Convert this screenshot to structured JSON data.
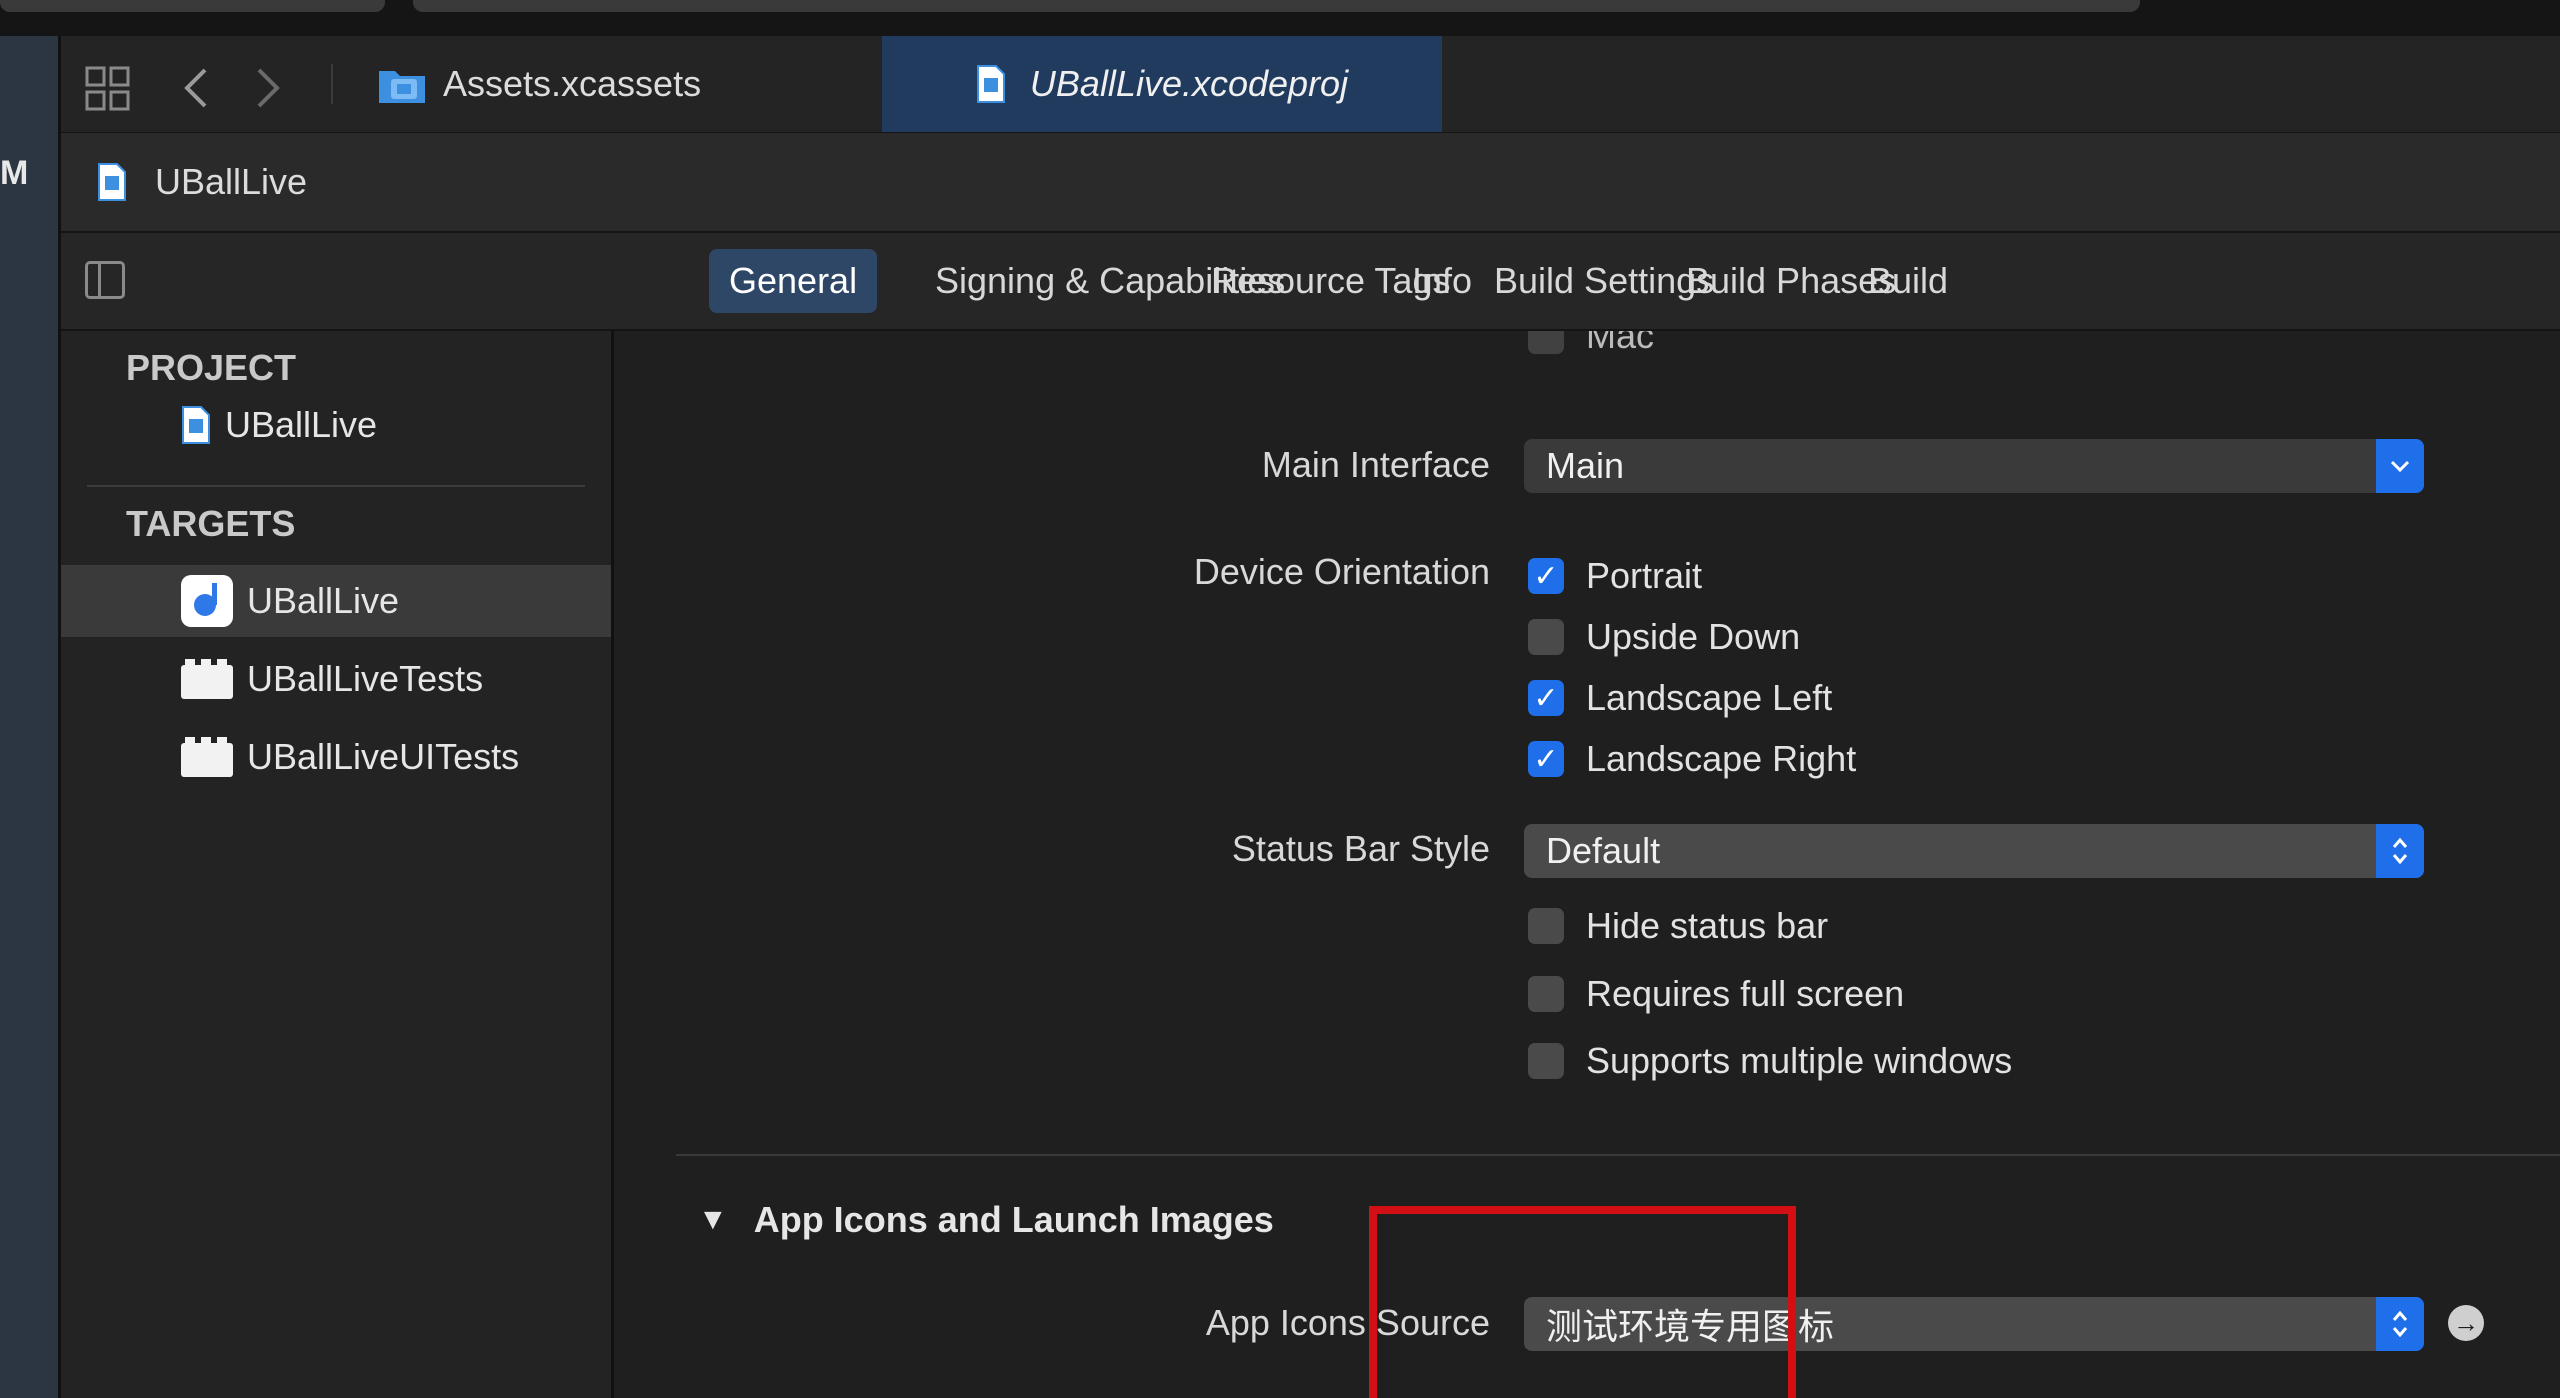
{
  "tabs": [
    {
      "label": "Assets.xcassets",
      "icon": "folder-icon",
      "active": false
    },
    {
      "label": "UBallLive.xcodeproj",
      "icon": "project-file-icon",
      "active": true
    }
  ],
  "breadcrumb": {
    "label": "UBallLive"
  },
  "left_strip_text": "M",
  "editor_tabs": [
    "General",
    "Signing & Capabilities",
    "Resource Tags",
    "Info",
    "Build Settings",
    "Build Phases",
    "Build"
  ],
  "sidebar": {
    "project_header": "PROJECT",
    "project_items": [
      "UBallLive"
    ],
    "targets_header": "TARGETS",
    "target_items": [
      "UBallLive",
      "UBallLiveTests",
      "UBallLiveUITests"
    ]
  },
  "general": {
    "cut_off_checkbox": "Mac",
    "main_interface": {
      "label": "Main Interface",
      "value": "Main"
    },
    "device_orientation": {
      "label": "Device Orientation",
      "options": [
        {
          "label": "Portrait",
          "checked": true
        },
        {
          "label": "Upside Down",
          "checked": false
        },
        {
          "label": "Landscape Left",
          "checked": true
        },
        {
          "label": "Landscape Right",
          "checked": true
        }
      ]
    },
    "status_bar_style": {
      "label": "Status Bar Style",
      "value": "Default"
    },
    "status_options": [
      {
        "label": "Hide status bar",
        "checked": false
      },
      {
        "label": "Requires full screen",
        "checked": false
      },
      {
        "label": "Supports multiple windows",
        "checked": false
      }
    ],
    "app_icons_section": {
      "title": "App Icons and Launch Images",
      "source_label": "App Icons Source",
      "source_value": "测试环境专用图标"
    }
  },
  "colors": {
    "accent": "#1f6feb",
    "highlight": "#d10f14",
    "active_tab": "#213b5e"
  }
}
